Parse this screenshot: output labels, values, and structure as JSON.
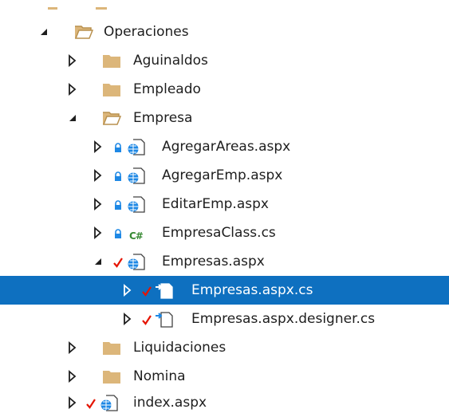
{
  "tree": {
    "items": [
      {
        "label": "Operaciones"
      },
      {
        "label": "Aguinaldos"
      },
      {
        "label": "Empleado"
      },
      {
        "label": "Empresa"
      },
      {
        "label": "AgregarAreas.aspx"
      },
      {
        "label": "AgregarEmp.aspx"
      },
      {
        "label": "EditarEmp.aspx"
      },
      {
        "label": "EmpresaClass.cs"
      },
      {
        "label": "Empresas.aspx"
      },
      {
        "label": "Empresas.aspx.cs"
      },
      {
        "label": "Empresas.aspx.designer.cs"
      },
      {
        "label": "Liquidaciones"
      },
      {
        "label": "Nomina"
      },
      {
        "label": "index.aspx"
      }
    ],
    "cs_badge": "C#"
  },
  "colors": {
    "selection": "#0e70c0",
    "folder": "#dcb67a",
    "check": "#e51400",
    "lock": "#1e88e5",
    "csharp": "#388a34"
  }
}
